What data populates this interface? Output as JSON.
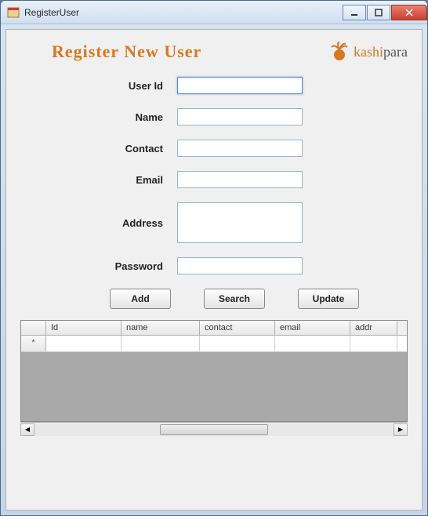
{
  "window": {
    "title": "RegisterUser"
  },
  "page": {
    "title": "Register New User"
  },
  "logo": {
    "brand_a": "kashi",
    "brand_b": "para"
  },
  "form": {
    "user_id": {
      "label": "User Id",
      "value": ""
    },
    "name": {
      "label": "Name",
      "value": ""
    },
    "contact": {
      "label": "Contact",
      "value": ""
    },
    "email": {
      "label": "Email",
      "value": ""
    },
    "address": {
      "label": "Address",
      "value": ""
    },
    "password": {
      "label": "Password",
      "value": ""
    }
  },
  "buttons": {
    "add": "Add",
    "search": "Search",
    "update": "Update"
  },
  "grid": {
    "columns": [
      "Id",
      "name",
      "contact",
      "email",
      "addr"
    ],
    "rows": []
  }
}
